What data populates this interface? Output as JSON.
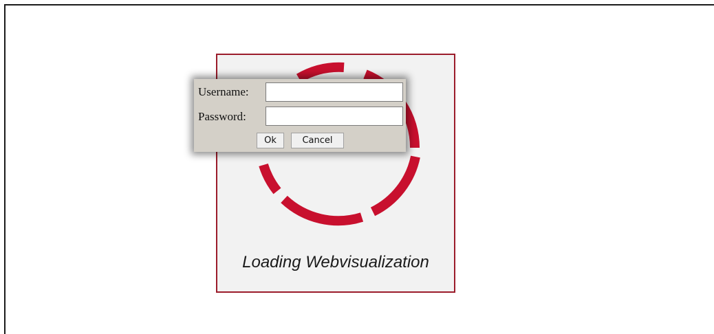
{
  "login": {
    "username_label": "Username:",
    "password_label": "Password:",
    "username_value": "",
    "password_value": "",
    "ok_label": "Ok",
    "cancel_label": "Cancel"
  },
  "loading": {
    "text": "Loading Webvisualization",
    "spinner_icon": "loading-spinner-icon"
  },
  "colors": {
    "accent": "#c8102e",
    "panel_border": "#9b1b2a",
    "panel_bg": "#f2f2f2",
    "dialog_bg": "#d4d0c8"
  }
}
